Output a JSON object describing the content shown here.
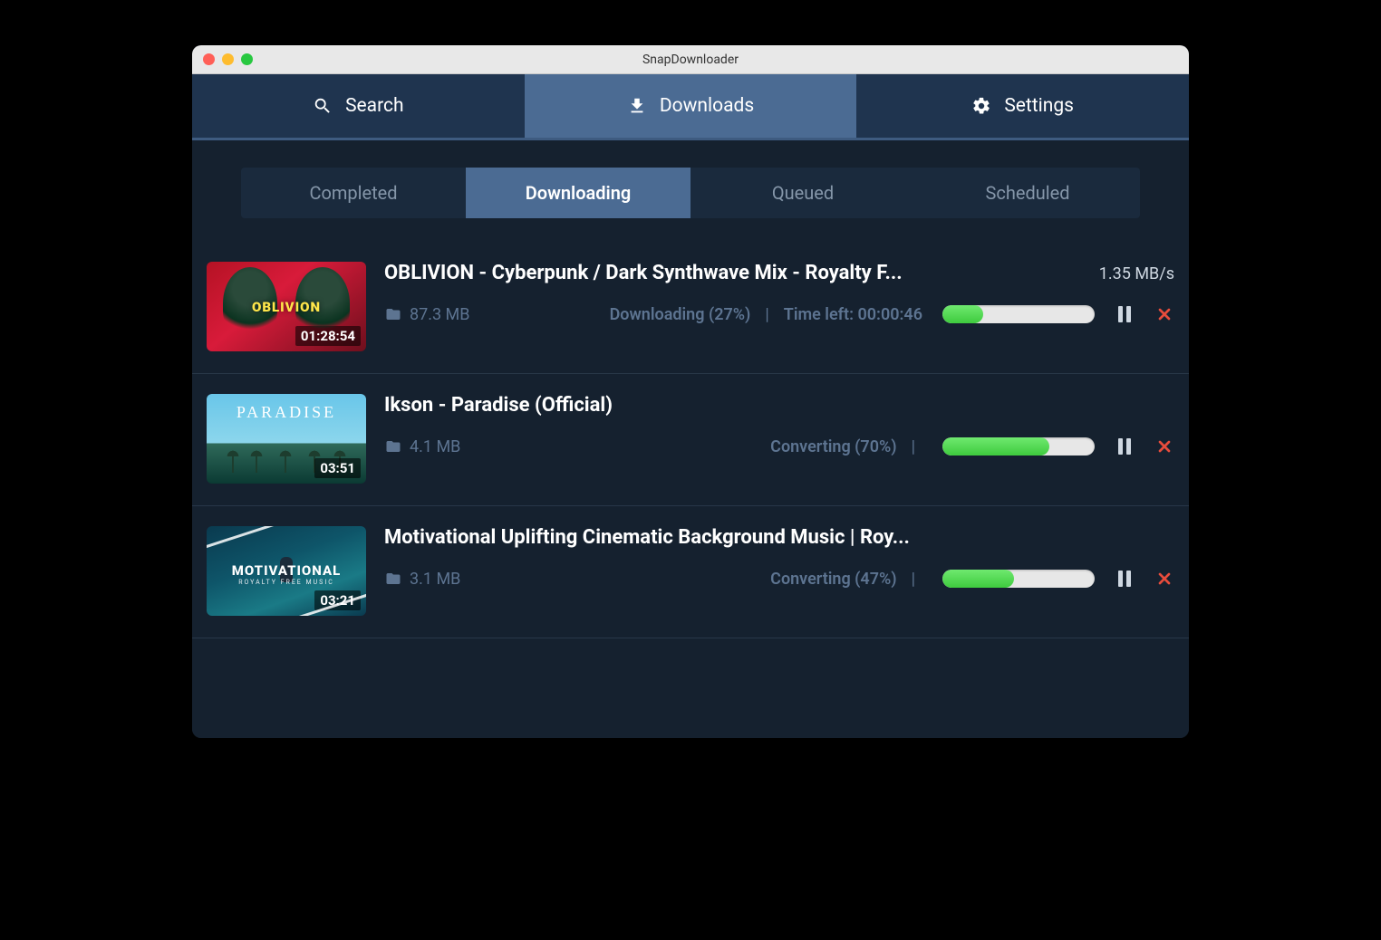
{
  "window": {
    "title": "SnapDownloader"
  },
  "mainTabs": {
    "search": {
      "label": "Search"
    },
    "downloads": {
      "label": "Downloads"
    },
    "settings": {
      "label": "Settings"
    },
    "activeIndex": 1
  },
  "subTabs": {
    "items": [
      {
        "label": "Completed"
      },
      {
        "label": "Downloading"
      },
      {
        "label": "Queued"
      },
      {
        "label": "Scheduled"
      }
    ],
    "activeIndex": 1
  },
  "downloads": [
    {
      "title": "OBLIVION - Cyberpunk / Dark Synthwave Mix - Royalty F...",
      "duration": "01:28:54",
      "size": "87.3 MB",
      "status": "Downloading (27%)",
      "timeLeft": "Time left: 00:00:46",
      "speed": "1.35 MB/s",
      "progressPercent": 27,
      "thumbLabel": "OBLIVION"
    },
    {
      "title": "Ikson - Paradise (Official)",
      "duration": "03:51",
      "size": "4.1 MB",
      "status": "Converting (70%)",
      "timeLeft": "",
      "speed": "",
      "progressPercent": 70,
      "thumbLabel": "PARADISE"
    },
    {
      "title": "Motivational Uplifting Cinematic Background Music | Roy...",
      "duration": "03:21",
      "size": "3.1 MB",
      "status": "Converting (47%)",
      "timeLeft": "",
      "speed": "",
      "progressPercent": 47,
      "thumbLabel1": "MOTIVATIONAL",
      "thumbLabel2": "ROYALTY FREE MUSIC"
    }
  ]
}
